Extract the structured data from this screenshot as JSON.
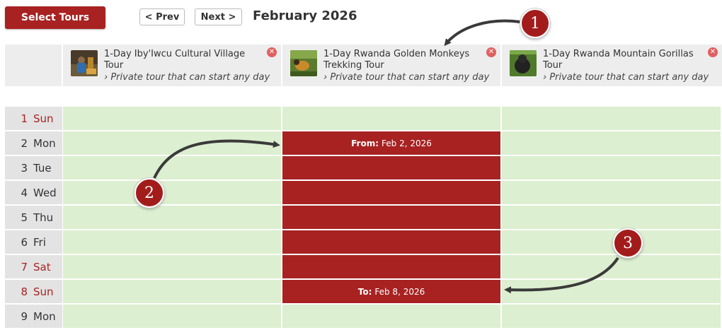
{
  "toolbar": {
    "select_tours_label": "Select Tours",
    "prev_label": "< Prev",
    "next_label": "Next >",
    "month_title": "February 2026"
  },
  "tours": [
    {
      "title": "1-Day Iby'Iwcu Cultural Village Tour",
      "subtitle": "› Private tour that can start any day",
      "thumb_icon": "cultural-village-photo"
    },
    {
      "title": "1-Day Rwanda Golden Monkeys Trekking Tour",
      "subtitle": "› Private tour that can start any day",
      "thumb_icon": "golden-monkey-photo"
    },
    {
      "title": "1-Day Rwanda Mountain Gorillas Tour",
      "subtitle": "› Private tour that can start any day",
      "thumb_icon": "gorilla-photo"
    }
  ],
  "calendar": {
    "days": [
      {
        "num": "1",
        "day": "Sun",
        "weekend": true
      },
      {
        "num": "2",
        "day": "Mon",
        "weekend": false
      },
      {
        "num": "3",
        "day": "Tue",
        "weekend": false
      },
      {
        "num": "4",
        "day": "Wed",
        "weekend": false
      },
      {
        "num": "5",
        "day": "Thu",
        "weekend": false
      },
      {
        "num": "6",
        "day": "Fri",
        "weekend": false
      },
      {
        "num": "7",
        "day": "Sat",
        "weekend": true
      },
      {
        "num": "8",
        "day": "Sun",
        "weekend": true
      },
      {
        "num": "9",
        "day": "Mon",
        "weekend": false
      }
    ],
    "from_label": "From:",
    "from_date": "Feb 2, 2026",
    "to_label": "To:",
    "to_date": "Feb 8, 2026"
  },
  "annotations": [
    "1",
    "2",
    "3"
  ],
  "colors": {
    "accent": "#a82222",
    "available_cell": "#dcefd0",
    "header_bg": "#ededed",
    "weekend_text": "#a82222"
  }
}
